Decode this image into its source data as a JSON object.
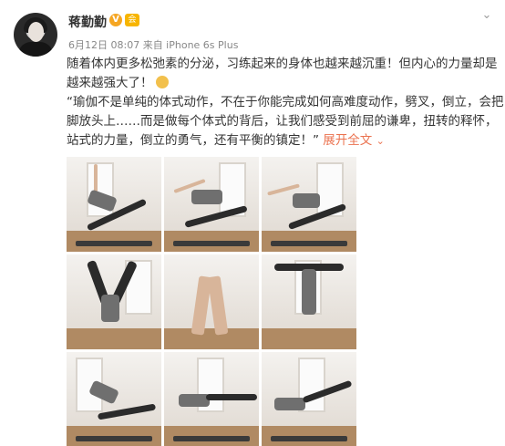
{
  "post": {
    "username": "蒋勤勤",
    "vip_badge": "V",
    "member_badge": "会",
    "meta": "6月12日 08:07 来自 iPhone 6s Plus",
    "menu_icon": "chevron-down-icon",
    "text_lines": [
      "随着体内更多松弛素的分泌，习练起来的身体也越来越沉重！但内心的力量却是",
      "越来越强大了！",
      "“瑜伽不是单纯的体式动作，不在于你能完成如何高难度动作，劈叉，倒立，会把",
      "脚放头上……而是做每个体式的背后，让我们感受到前屈的谦卑，扭转的释怀，",
      "站式的力量，倒立的勇气，还有平衡的镇定！”"
    ],
    "expand_label": "展开全文",
    "expand_icon": "chevron-down-icon"
  },
  "photos": [
    {
      "pose": "triangle-pose"
    },
    {
      "pose": "revolved-triangle-pose"
    },
    {
      "pose": "extended-side-angle"
    },
    {
      "pose": "headstand"
    },
    {
      "pose": "prayer-hands-closeup"
    },
    {
      "pose": "wide-leg-headstand"
    },
    {
      "pose": "lunge-twist"
    },
    {
      "pose": "warrior-three-variation"
    },
    {
      "pose": "side-plank-leg-lift"
    }
  ],
  "colors": {
    "link": "#eb7350",
    "username": "#333333",
    "meta": "#888888"
  }
}
